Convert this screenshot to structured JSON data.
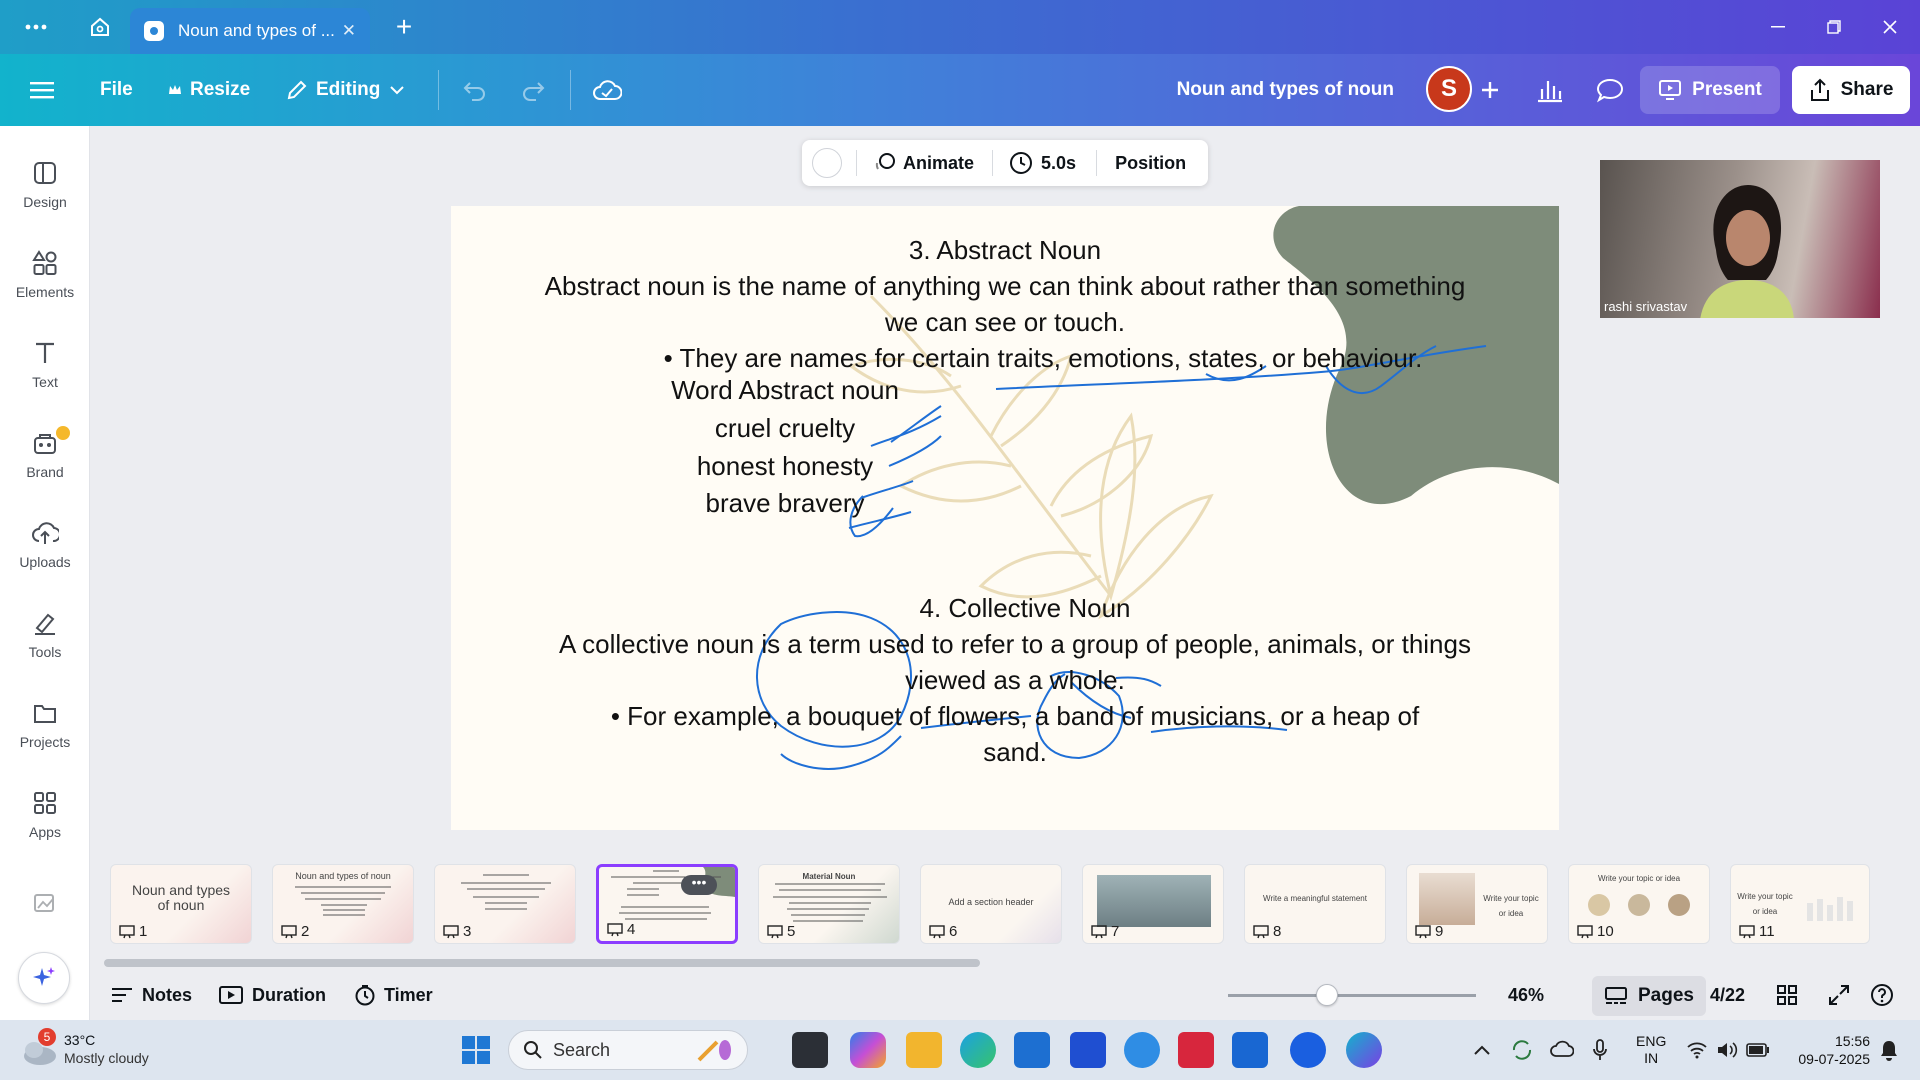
{
  "browser": {
    "tab_title": "Noun and types of ...",
    "tab_close": "✕",
    "new_tab": "+"
  },
  "toolbar": {
    "file": "File",
    "resize": "Resize",
    "editing": "Editing",
    "doc_title": "Noun and types of noun",
    "avatar_letter": "S",
    "present": "Present",
    "share": "Share"
  },
  "sidebar": {
    "items": [
      {
        "label": "Design"
      },
      {
        "label": "Elements"
      },
      {
        "label": "Text"
      },
      {
        "label": "Brand"
      },
      {
        "label": "Uploads"
      },
      {
        "label": "Tools"
      },
      {
        "label": "Projects"
      },
      {
        "label": "Apps"
      }
    ]
  },
  "float_toolbar": {
    "animate": "Animate",
    "duration": "5.0s",
    "position": "Position"
  },
  "slide": {
    "heading1": "3. Abstract Noun",
    "para1_line1": "Abstract noun is the name of anything we can think about rather than something",
    "para1_line2": "we can see or touch.",
    "bullet1": "• They are names for certain traits, emotions, states, or behaviour.",
    "table": [
      "Word Abstract noun",
      "cruel cruelty",
      "honest honesty",
      "brave bravery"
    ],
    "heading2": "4. Collective Noun",
    "para2_line1": "A collective noun is a term used to refer to a group of people, animals, or things",
    "para2_line2": "viewed as a whole.",
    "bullet2_line1": "• For example, a bouquet of flowers, a band of musicians, or a heap of",
    "bullet2_line2": "sand."
  },
  "video": {
    "participant": "rashi srivastav"
  },
  "thumbnails": [
    {
      "num": "1",
      "text": "Noun and types of noun"
    },
    {
      "num": "2",
      "text": "Noun and types of noun"
    },
    {
      "num": "3",
      "text": ""
    },
    {
      "num": "4",
      "text": ""
    },
    {
      "num": "5",
      "text": "Material Noun"
    },
    {
      "num": "6",
      "text": "Add a section header"
    },
    {
      "num": "7",
      "text": ""
    },
    {
      "num": "8",
      "text": "Write a meaningful statement"
    },
    {
      "num": "9",
      "text": "Write your topic or idea"
    },
    {
      "num": "10",
      "text": "Write your topic or idea"
    },
    {
      "num": "11",
      "text": "Write your topic or idea"
    }
  ],
  "bottombar": {
    "notes": "Notes",
    "duration": "Duration",
    "timer": "Timer",
    "zoom": "46%",
    "zoom_level": 0.46,
    "pages": "Pages",
    "page_counter": "4/22"
  },
  "taskbar": {
    "weather_temp": "33°C",
    "weather_desc": "Mostly cloudy",
    "weather_badge": "5",
    "search": "Search",
    "lang_line1": "ENG",
    "lang_line2": "IN",
    "time": "15:56",
    "date": "09-07-2025"
  },
  "colors": {
    "accent_purple": "#8b3dff",
    "avatar_bg": "#c8381b",
    "pen_ink": "#1f6fd6",
    "blob_green": "#7e8c7a"
  }
}
